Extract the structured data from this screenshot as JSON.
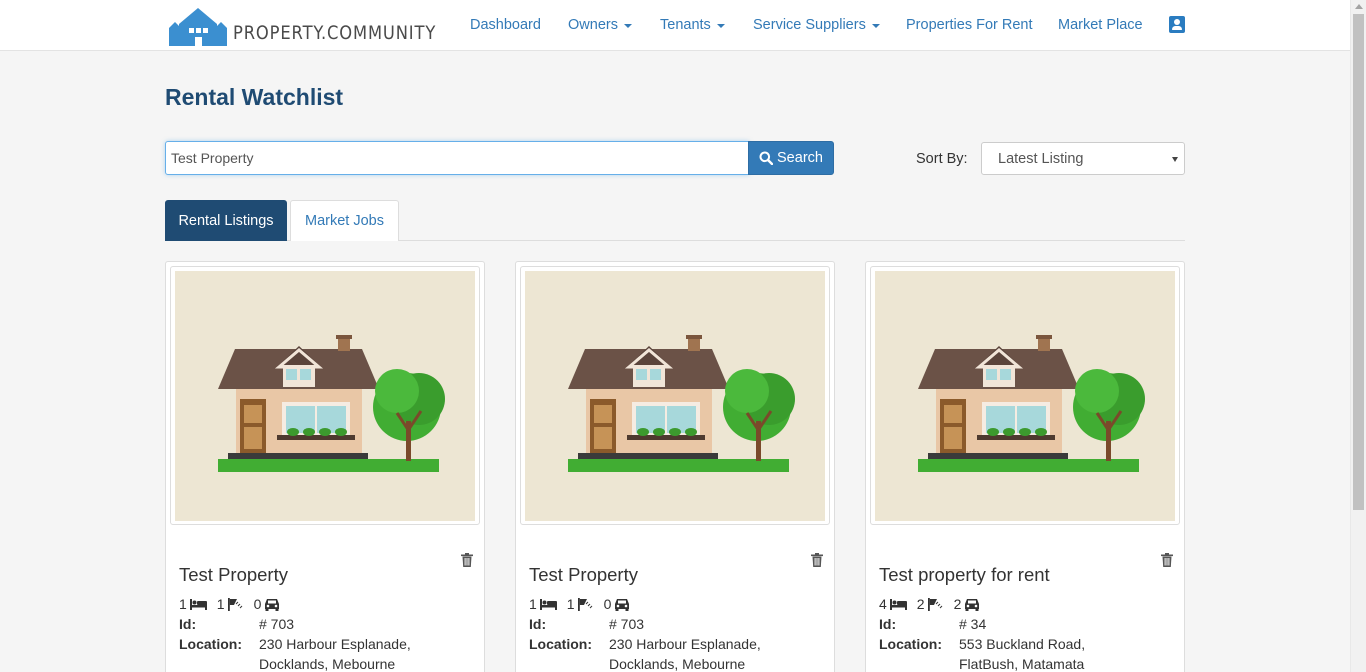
{
  "brand": {
    "name": "PROPERTY.COMMUNITY"
  },
  "nav": {
    "dashboard": "Dashboard",
    "owners": "Owners",
    "tenants": "Tenants",
    "service_suppliers": "Service Suppliers",
    "properties_for_rent": "Properties For Rent",
    "market_place": "Market Place"
  },
  "page": {
    "title": "Rental Watchlist"
  },
  "search": {
    "value": "Test Property",
    "button_label": "Search"
  },
  "sort": {
    "label": "Sort By:",
    "selected": "Latest Listing"
  },
  "tabs": [
    {
      "label": "Rental Listings",
      "active": true
    },
    {
      "label": "Market Jobs",
      "active": false
    }
  ],
  "labels": {
    "id": "Id:",
    "location": "Location:"
  },
  "listings": [
    {
      "title": "Test Property",
      "beds": "1",
      "baths": "1",
      "cars": "0",
      "id": "# 703",
      "location_line1": "230 Harbour Esplanade,",
      "location_line2": "Docklands, Mebourne"
    },
    {
      "title": "Test Property",
      "beds": "1",
      "baths": "1",
      "cars": "0",
      "id": "# 703",
      "location_line1": "230 Harbour Esplanade,",
      "location_line2": "Docklands, Mebourne"
    },
    {
      "title": "Test property for rent",
      "beds": "4",
      "baths": "2",
      "cars": "2",
      "id": "# 34",
      "location_line1": "553 Buckland Road,",
      "location_line2": "FlatBush, Matamata"
    }
  ],
  "colors": {
    "accent": "#337ab7",
    "title": "#1f4b73",
    "image_bg": "#ede6d3"
  },
  "icons": [
    "house-logo-icon",
    "profile-icon",
    "search-icon",
    "trash-icon",
    "bed-icon",
    "bath-icon",
    "car-icon",
    "house-illustration"
  ]
}
